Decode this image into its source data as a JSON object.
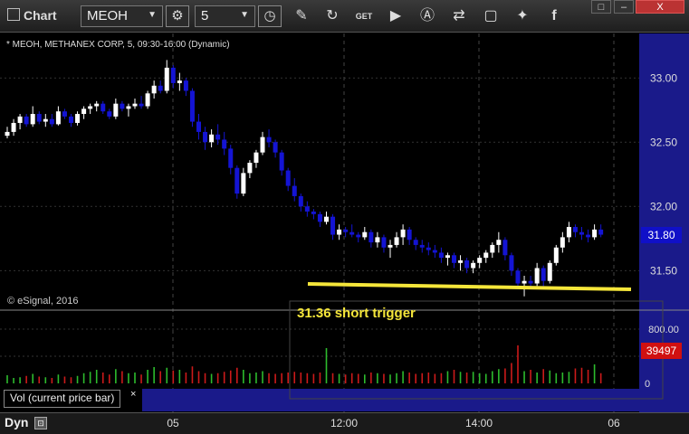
{
  "toolbar": {
    "title": "Chart",
    "symbol": "MEOH",
    "interval": "5",
    "icons": [
      "settings-icon",
      "clock-icon",
      "pencil-icon",
      "refresh-icon",
      "get-icon",
      "play-icon",
      "alert-icon",
      "link-icon",
      "comment-icon",
      "twitter-icon",
      "facebook-icon"
    ],
    "window_controls": [
      "□",
      "–",
      "X"
    ]
  },
  "chart": {
    "symbol_label": "* MEOH, METHANEX CORP, 5, 09:30-16:00 (Dynamic)",
    "copyright": "© eSignal, 2016",
    "annotation": "31.36 short trigger",
    "last_price": "31.80",
    "volume_last": "39497",
    "volume_legend": "Vol (current price bar)",
    "volume_close": "×",
    "dyn_label": "Dyn",
    "colors": {
      "up": "#ffffff",
      "down": "#1414d4",
      "price_axis": "#1a1a8a",
      "annotation": "#f5e63a",
      "vol_up": "#2dbb2d",
      "vol_down": "#cc1a1a"
    }
  },
  "chart_data": {
    "type": "candlestick",
    "y_axis": {
      "ticks": [
        "33.00",
        "32.50",
        "32.00",
        "31.50"
      ],
      "range": [
        31.27,
        33.22
      ]
    },
    "vol_axis": {
      "ticks": [
        "800.00",
        "0"
      ],
      "range": [
        0,
        1000
      ]
    },
    "x_axis": {
      "ticks": [
        "05",
        "12:00",
        "14:00",
        "06"
      ]
    },
    "trigger_line": {
      "value": 31.36,
      "label": "31.36 short trigger"
    },
    "candles": [
      [
        32.55,
        32.62,
        32.53,
        32.58
      ],
      [
        32.58,
        32.68,
        32.55,
        32.65
      ],
      [
        32.65,
        32.72,
        32.6,
        32.7
      ],
      [
        32.7,
        32.72,
        32.62,
        32.64
      ],
      [
        32.64,
        32.78,
        32.62,
        32.72
      ],
      [
        32.72,
        32.74,
        32.64,
        32.66
      ],
      [
        32.66,
        32.72,
        32.62,
        32.68
      ],
      [
        32.68,
        32.72,
        32.62,
        32.64
      ],
      [
        32.64,
        32.78,
        32.63,
        32.74
      ],
      [
        32.74,
        32.76,
        32.68,
        32.7
      ],
      [
        32.7,
        32.72,
        32.62,
        32.65
      ],
      [
        32.65,
        32.74,
        32.63,
        32.72
      ],
      [
        32.72,
        32.78,
        32.68,
        32.76
      ],
      [
        32.76,
        32.8,
        32.72,
        32.78
      ],
      [
        32.78,
        32.82,
        32.74,
        32.8
      ],
      [
        32.8,
        32.82,
        32.72,
        32.74
      ],
      [
        32.74,
        32.76,
        32.68,
        32.7
      ],
      [
        32.7,
        32.84,
        32.68,
        32.8
      ],
      [
        32.8,
        32.82,
        32.74,
        32.76
      ],
      [
        32.76,
        32.8,
        32.7,
        32.78
      ],
      [
        32.78,
        32.84,
        32.76,
        32.8
      ],
      [
        32.8,
        32.86,
        32.76,
        32.78
      ],
      [
        32.78,
        32.9,
        32.76,
        32.88
      ],
      [
        32.88,
        32.98,
        32.84,
        32.94
      ],
      [
        32.94,
        32.98,
        32.88,
        32.9
      ],
      [
        32.9,
        33.14,
        32.88,
        33.08
      ],
      [
        33.08,
        33.1,
        32.92,
        32.96
      ],
      [
        32.96,
        33.04,
        32.9,
        32.98
      ],
      [
        32.98,
        33.0,
        32.86,
        32.9
      ],
      [
        32.9,
        32.92,
        32.62,
        32.66
      ],
      [
        32.66,
        32.72,
        32.52,
        32.58
      ],
      [
        32.58,
        32.62,
        32.44,
        32.5
      ],
      [
        32.5,
        32.6,
        32.46,
        32.56
      ],
      [
        32.56,
        32.64,
        32.48,
        32.52
      ],
      [
        32.52,
        32.58,
        32.4,
        32.45
      ],
      [
        32.45,
        32.48,
        32.25,
        32.3
      ],
      [
        32.3,
        32.32,
        32.06,
        32.1
      ],
      [
        32.1,
        32.3,
        32.08,
        32.26
      ],
      [
        32.26,
        32.36,
        32.22,
        32.34
      ],
      [
        32.34,
        32.44,
        32.3,
        32.42
      ],
      [
        32.42,
        32.58,
        32.4,
        32.54
      ],
      [
        32.54,
        32.6,
        32.46,
        32.5
      ],
      [
        32.5,
        32.52,
        32.38,
        32.42
      ],
      [
        32.42,
        32.44,
        32.24,
        32.28
      ],
      [
        32.28,
        32.3,
        32.12,
        32.16
      ],
      [
        32.16,
        32.22,
        32.04,
        32.08
      ],
      [
        32.08,
        32.1,
        31.96,
        32.0
      ],
      [
        32.0,
        32.04,
        31.92,
        31.96
      ],
      [
        31.96,
        31.98,
        31.9,
        31.94
      ],
      [
        31.94,
        31.96,
        31.84,
        31.88
      ],
      [
        31.88,
        31.96,
        31.86,
        31.92
      ],
      [
        31.92,
        31.94,
        31.74,
        31.78
      ],
      [
        31.78,
        31.86,
        31.74,
        31.82
      ],
      [
        31.82,
        31.84,
        31.76,
        31.8
      ],
      [
        31.8,
        31.86,
        31.76,
        31.78
      ],
      [
        31.78,
        31.8,
        31.72,
        31.76
      ],
      [
        31.76,
        31.84,
        31.74,
        31.8
      ],
      [
        31.8,
        31.82,
        31.68,
        31.72
      ],
      [
        31.72,
        31.8,
        31.68,
        31.76
      ],
      [
        31.76,
        31.78,
        31.64,
        31.68
      ],
      [
        31.68,
        31.74,
        31.6,
        31.7
      ],
      [
        31.7,
        31.8,
        31.68,
        31.76
      ],
      [
        31.76,
        31.86,
        31.7,
        31.82
      ],
      [
        31.82,
        31.84,
        31.7,
        31.74
      ],
      [
        31.74,
        31.76,
        31.66,
        31.7
      ],
      [
        31.7,
        31.74,
        31.64,
        31.68
      ],
      [
        31.68,
        31.72,
        31.62,
        31.66
      ],
      [
        31.66,
        31.7,
        31.6,
        31.64
      ],
      [
        31.64,
        31.68,
        31.56,
        31.6
      ],
      [
        31.6,
        31.64,
        31.54,
        31.62
      ],
      [
        31.62,
        31.64,
        31.52,
        31.56
      ],
      [
        31.56,
        31.62,
        31.5,
        31.58
      ],
      [
        31.58,
        31.6,
        31.48,
        31.52
      ],
      [
        31.52,
        31.58,
        31.48,
        31.56
      ],
      [
        31.56,
        31.62,
        31.52,
        31.6
      ],
      [
        31.6,
        31.66,
        31.56,
        31.64
      ],
      [
        31.64,
        31.72,
        31.6,
        31.7
      ],
      [
        31.7,
        31.8,
        31.64,
        31.74
      ],
      [
        31.74,
        31.76,
        31.58,
        31.62
      ],
      [
        31.62,
        31.64,
        31.46,
        31.5
      ],
      [
        31.5,
        31.52,
        31.36,
        31.4
      ],
      [
        31.4,
        31.46,
        31.3,
        31.42
      ],
      [
        31.42,
        31.46,
        31.36,
        31.4
      ],
      [
        31.4,
        31.56,
        31.38,
        31.52
      ],
      [
        31.52,
        31.54,
        31.38,
        31.42
      ],
      [
        31.42,
        31.58,
        31.4,
        31.56
      ],
      [
        31.56,
        31.7,
        31.54,
        31.68
      ],
      [
        31.68,
        31.8,
        31.64,
        31.76
      ],
      [
        31.76,
        31.88,
        31.72,
        31.84
      ],
      [
        31.84,
        31.86,
        31.76,
        31.8
      ],
      [
        31.8,
        31.84,
        31.74,
        31.78
      ],
      [
        31.78,
        31.82,
        31.72,
        31.76
      ],
      [
        31.76,
        31.86,
        31.74,
        31.82
      ],
      [
        31.82,
        31.86,
        31.76,
        31.78
      ]
    ],
    "volume": [
      120,
      80,
      90,
      110,
      140,
      100,
      90,
      80,
      130,
      100,
      90,
      110,
      150,
      170,
      200,
      160,
      130,
      210,
      180,
      150,
      160,
      130,
      200,
      240,
      180,
      230,
      190,
      200,
      160,
      250,
      180,
      150,
      140,
      150,
      170,
      190,
      230,
      200,
      150,
      160,
      180,
      150,
      140,
      150,
      160,
      170,
      160,
      150,
      140,
      160,
      520,
      150,
      140,
      130,
      150,
      140,
      130,
      160,
      150,
      140,
      130,
      150,
      180,
      160,
      140,
      150,
      160,
      140,
      150,
      180,
      200,
      170,
      160,
      170,
      150,
      140,
      180,
      210,
      220,
      300,
      560,
      180,
      200,
      160,
      210,
      190,
      150,
      160,
      170,
      220,
      230,
      200,
      280,
      150
    ]
  }
}
